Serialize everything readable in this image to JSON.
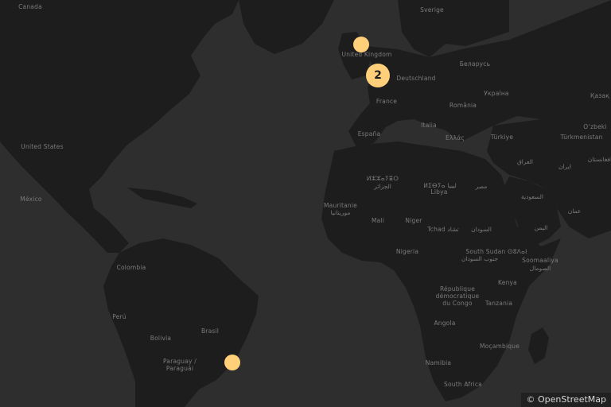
{
  "map": {
    "colors": {
      "water": "#2e2e2e",
      "land": "#1d1d1d",
      "label": "#7b7b7b",
      "marker": "#ffcf7a"
    },
    "labels": [
      {
        "id": "canada",
        "text": "Canada"
      },
      {
        "id": "sverige",
        "text": "Sverige"
      },
      {
        "id": "united-kingdom",
        "text": "United Kingdom"
      },
      {
        "id": "belarus",
        "text": "Беларусь"
      },
      {
        "id": "deutschland",
        "text": "Deutschland"
      },
      {
        "id": "ukraina",
        "text": "Україна"
      },
      {
        "id": "kazakh",
        "text": "Қазақ"
      },
      {
        "id": "france",
        "text": "France"
      },
      {
        "id": "romania",
        "text": "România"
      },
      {
        "id": "united-states",
        "text": "United States"
      },
      {
        "id": "italia",
        "text": "Italia"
      },
      {
        "id": "uzbekiston",
        "text": "O‘zbeki"
      },
      {
        "id": "espana",
        "text": "España"
      },
      {
        "id": "ellada",
        "text": "Ελλάς"
      },
      {
        "id": "turkiye",
        "text": "Türkiye"
      },
      {
        "id": "turkmenistan",
        "text": "Türkmenistan"
      },
      {
        "id": "iraq",
        "text": "العراق"
      },
      {
        "id": "iran",
        "text": "ایران"
      },
      {
        "id": "afghanistan",
        "text": "افغانستان"
      },
      {
        "id": "algeria-tifinagh",
        "text": "ⵍⵣⵣⴰⵢⴻⵔ"
      },
      {
        "id": "algeria-ar",
        "text": "الجزائر"
      },
      {
        "id": "libya-tifinagh",
        "text": "ⵍⵉⴱⵢⴰ ليبيا"
      },
      {
        "id": "libya",
        "text": "Libya"
      },
      {
        "id": "misr",
        "text": "مصر"
      },
      {
        "id": "mexico",
        "text": "México"
      },
      {
        "id": "saudi",
        "text": "السعودية"
      },
      {
        "id": "oman",
        "text": "عمان"
      },
      {
        "id": "mauritanie",
        "text": "Mauritanie"
      },
      {
        "id": "mauritanie-ar",
        "text": "موريتانيا"
      },
      {
        "id": "mali",
        "text": "Mali"
      },
      {
        "id": "niger",
        "text": "Niger"
      },
      {
        "id": "tchad",
        "text": "Tchad تشاد"
      },
      {
        "id": "sudan",
        "text": "السودان"
      },
      {
        "id": "yemen",
        "text": "اليمن"
      },
      {
        "id": "nigeria",
        "text": "Nigeria"
      },
      {
        "id": "south-sudan",
        "text": "South Sudan ⵙⵓⴷⴰⵏ"
      },
      {
        "id": "south-sudan-ar",
        "text": "جنوب السودان"
      },
      {
        "id": "somalia",
        "text": "Soomaaliya"
      },
      {
        "id": "somalia-ar",
        "text": "الصومال"
      },
      {
        "id": "colombia",
        "text": "Colombia"
      },
      {
        "id": "rdc",
        "text": "République\ndémocratique\ndu Congo"
      },
      {
        "id": "kenya",
        "text": "Kenya"
      },
      {
        "id": "tanzania",
        "text": "Tanzania"
      },
      {
        "id": "peru",
        "text": "Perú"
      },
      {
        "id": "brasil",
        "text": "Brasil"
      },
      {
        "id": "angola",
        "text": "Angola"
      },
      {
        "id": "bolivia",
        "text": "Bolivia"
      },
      {
        "id": "mocambique",
        "text": "Moçambique"
      },
      {
        "id": "paraguay",
        "text": "Paraguay /\nParaguái"
      },
      {
        "id": "namibia",
        "text": "Namibia"
      },
      {
        "id": "south-africa",
        "text": "South Africa"
      }
    ],
    "markers": [
      {
        "id": "marker-uk",
        "type": "single",
        "label": ""
      },
      {
        "id": "marker-cluster",
        "type": "cluster",
        "label": "2"
      },
      {
        "id": "marker-brazil",
        "type": "single",
        "label": ""
      }
    ],
    "attribution": {
      "symbol": "©",
      "text": "OpenStreetMap"
    }
  }
}
